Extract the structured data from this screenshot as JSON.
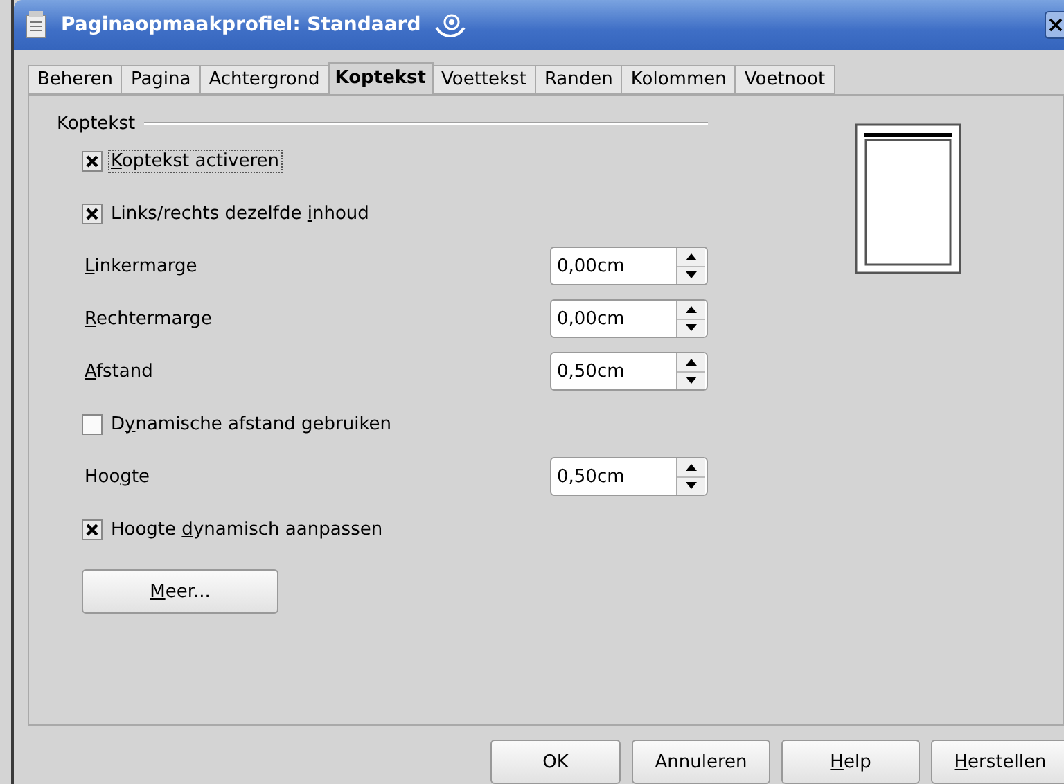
{
  "window": {
    "title": "Paginaopmaakprofiel: Standaard"
  },
  "tabs": [
    {
      "label": "Beheren",
      "selected": false
    },
    {
      "label": "Pagina",
      "selected": false
    },
    {
      "label": "Achtergrond",
      "selected": false
    },
    {
      "label": "Koptekst",
      "selected": true
    },
    {
      "label": "Voettekst",
      "selected": false
    },
    {
      "label": "Randen",
      "selected": false
    },
    {
      "label": "Kolommen",
      "selected": false
    },
    {
      "label": "Voetnoot",
      "selected": false
    }
  ],
  "group": {
    "title": "Koptekst"
  },
  "rows": [
    {
      "kind": "checkbox",
      "label": {
        "key": "K",
        "after": "optekst activeren"
      },
      "checked": true,
      "focused": true
    },
    {
      "kind": "checkbox",
      "label": {
        "before": "Links/rechts dezelfde ",
        "key": "i",
        "after": "nhoud"
      },
      "checked": true,
      "focused": false
    },
    {
      "kind": "spin",
      "label": {
        "key": "L",
        "after": "inkermarge"
      },
      "value": "0,00cm"
    },
    {
      "kind": "spin",
      "label": {
        "key": "R",
        "after": "echtermarge"
      },
      "value": "0,00cm"
    },
    {
      "kind": "spin",
      "label": {
        "key": "A",
        "after": "fstand"
      },
      "value": "0,50cm"
    },
    {
      "kind": "checkbox",
      "label": {
        "before": "D",
        "key": "y",
        "after": "namische afstand gebruiken"
      },
      "checked": false,
      "focused": false
    },
    {
      "kind": "spin",
      "label": {
        "before": "Hoo",
        "key": "g",
        "after": "te"
      },
      "value": "0,50cm"
    },
    {
      "kind": "checkbox",
      "label": {
        "before": "Hoogte ",
        "key": "d",
        "after": "ynamisch aanpassen"
      },
      "checked": true,
      "focused": false
    },
    {
      "kind": "button",
      "label": {
        "key": "M",
        "after": "eer..."
      }
    }
  ],
  "buttons": [
    {
      "before": "OK"
    },
    {
      "before": "Annuleren"
    },
    {
      "key": "H",
      "after": "elp"
    },
    {
      "key": "H",
      "after": "erstellen"
    }
  ]
}
